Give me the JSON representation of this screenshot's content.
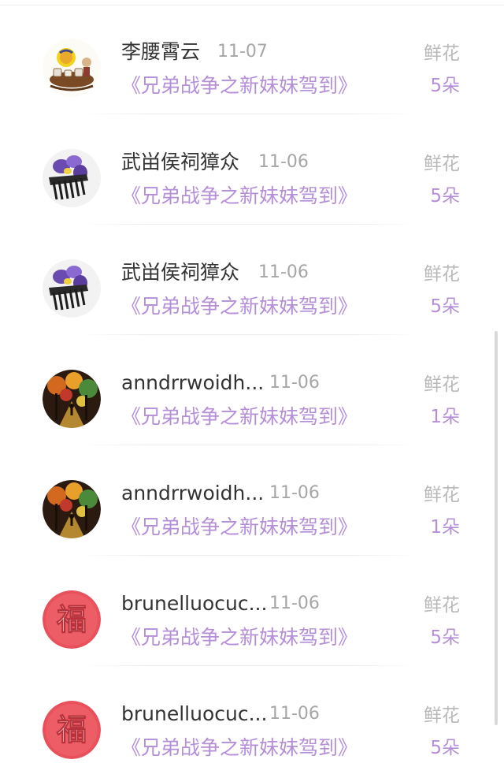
{
  "gifts": [
    {
      "name": "李腰霄云",
      "date": "11-07",
      "title": "《兄弟战争之新妹妹驾到》",
      "gift_type": "鲜花",
      "count": "5朵",
      "avatar_icon": "tea-scene-avatar-icon"
    },
    {
      "name": "武畄侯祠獐众",
      "date": "11-06",
      "title": "《兄弟战争之新妹妹驾到》",
      "gift_type": "鲜花",
      "count": "5朵",
      "avatar_icon": "iris-flower-avatar-icon"
    },
    {
      "name": "武畄侯祠獐众",
      "date": "11-06",
      "title": "《兄弟战争之新妹妹驾到》",
      "gift_type": "鲜花",
      "count": "5朵",
      "avatar_icon": "iris-flower-avatar-icon"
    },
    {
      "name": "anndrrwoidh...",
      "date": "11-06",
      "title": "《兄弟战争之新妹妹驾到》",
      "gift_type": "鲜花",
      "count": "1朵",
      "avatar_icon": "autumn-painting-avatar-icon"
    },
    {
      "name": "anndrrwoidh...",
      "date": "11-06",
      "title": "《兄弟战争之新妹妹驾到》",
      "gift_type": "鲜花",
      "count": "1朵",
      "avatar_icon": "autumn-painting-avatar-icon"
    },
    {
      "name": "brunelluocuc...",
      "date": "11-06",
      "title": "《兄弟战争之新妹妹驾到》",
      "gift_type": "鲜花",
      "count": "5朵",
      "avatar_icon": "fu-character-avatar-icon"
    },
    {
      "name": "brunelluocuc...",
      "date": "11-06",
      "title": "《兄弟战争之新妹妹驾到》",
      "gift_type": "鲜花",
      "count": "5朵",
      "avatar_icon": "fu-character-avatar-icon"
    }
  ],
  "fu_char": "福",
  "colors": {
    "name": "#333333",
    "date": "#a6a6a6",
    "title_accent": "#b48fd8",
    "gift_type": "#b9b9b9",
    "fu_red": "#e8505b"
  }
}
